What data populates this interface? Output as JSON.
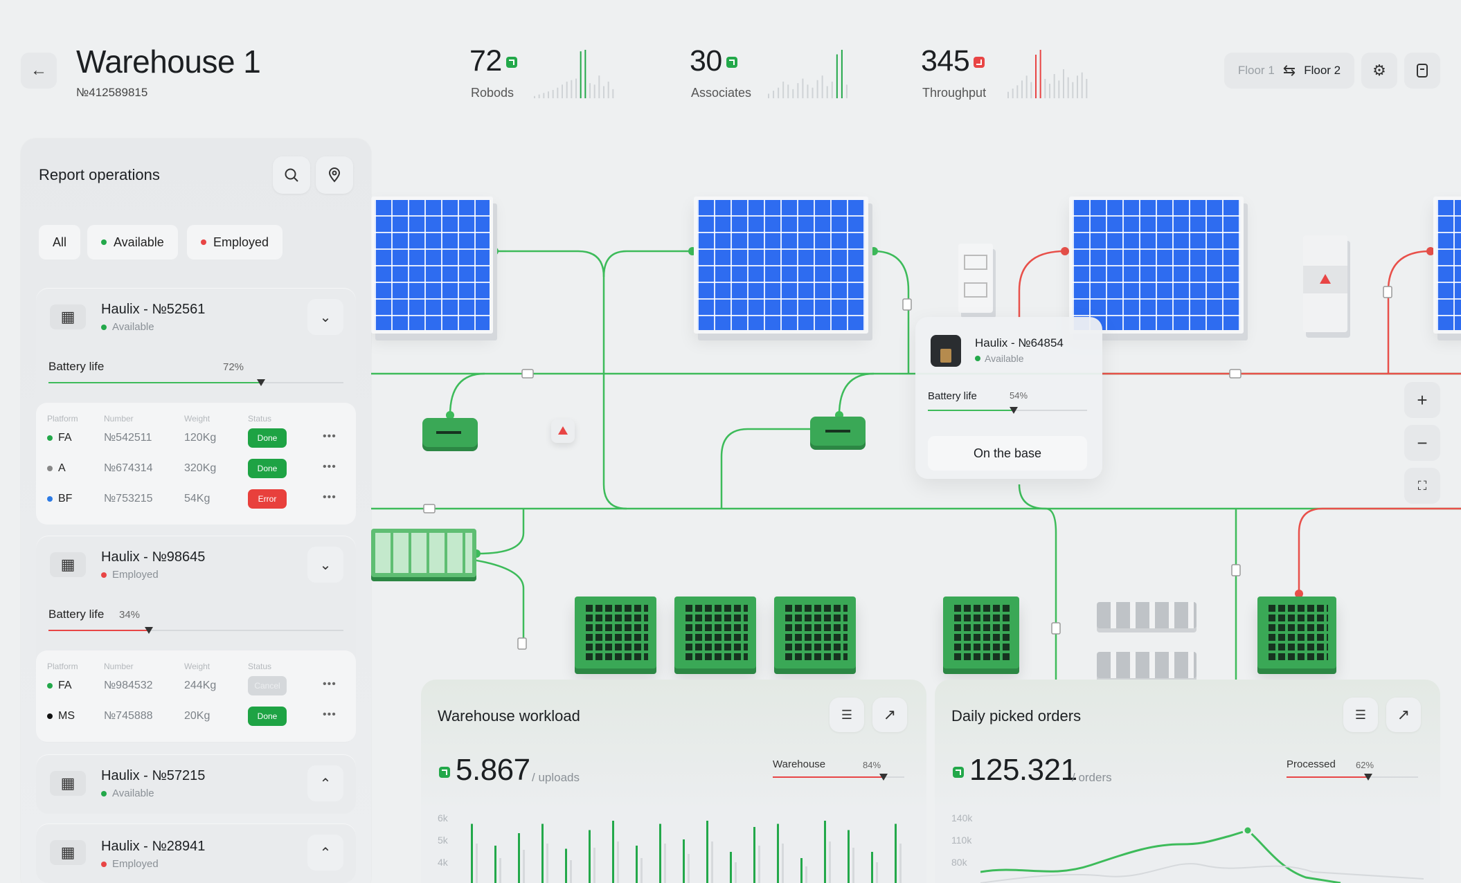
{
  "header": {
    "title": "Warehouse 1",
    "id": "№412589815",
    "stats": [
      {
        "value": "72",
        "label": "Robods",
        "trend": "up",
        "bars": [
          3,
          5,
          7,
          9,
          11,
          14,
          18,
          22,
          24,
          26,
          62,
          64,
          20,
          18,
          30,
          16,
          22,
          12
        ],
        "accent_index": [
          10,
          11
        ],
        "accent": "#23a84a"
      },
      {
        "value": "30",
        "label": "Associates",
        "trend": "up",
        "bars": [
          6,
          10,
          14,
          22,
          18,
          12,
          20,
          26,
          18,
          14,
          24,
          30,
          16,
          22,
          58,
          64,
          18
        ],
        "accent_index": [
          14,
          15
        ],
        "accent": "#23a84a"
      },
      {
        "value": "345",
        "label": "Throughput",
        "trend": "down",
        "bars": [
          8,
          12,
          16,
          22,
          28,
          20,
          54,
          60,
          24,
          18,
          30,
          22,
          36,
          26,
          20,
          28,
          32,
          24
        ],
        "accent_index": [
          6,
          7
        ],
        "accent": "#e84545"
      }
    ],
    "floor_1": "Floor 1",
    "floor_2": "Floor 2"
  },
  "icons": {
    "back": "arrow-left-icon",
    "swap": "swap-icon",
    "settings": "gear-icon",
    "notes": "note-icon",
    "search": "search-icon",
    "pin": "location-pin-icon"
  },
  "panel": {
    "title": "Report operations",
    "filters": [
      "All",
      "Available",
      "Employed"
    ],
    "robots": [
      {
        "name": "Haulix - №52561",
        "status": "Available",
        "battery_label": "Battery life",
        "battery_pct": "72%",
        "battery": 0.72,
        "headers": [
          "Platform",
          "Number",
          "Weight",
          "Status"
        ],
        "rows": [
          {
            "platform": "FA",
            "dot": "g",
            "number": "№542511",
            "weight": "120Kg",
            "status": "Done"
          },
          {
            "platform": "A",
            "dot": "gray",
            "number": "№674314",
            "weight": "320Kg",
            "status": "Done"
          },
          {
            "platform": "BF",
            "dot": "b",
            "number": "№753215",
            "weight": "54Kg",
            "status": "Error"
          }
        ]
      },
      {
        "name": "Haulix - №98645",
        "status": "Employed",
        "battery_label": "Battery life",
        "battery_pct": "34%",
        "battery": 0.34,
        "headers": [
          "Platform",
          "Number",
          "Weight",
          "Status"
        ],
        "rows": [
          {
            "platform": "FA",
            "dot": "g",
            "number": "№984532",
            "weight": "244Kg",
            "status": "Cancel"
          },
          {
            "platform": "MS",
            "dot": "k",
            "number": "№745888",
            "weight": "20Kg",
            "status": "Done"
          }
        ]
      },
      {
        "name": "Haulix - №57215",
        "status": "Available"
      },
      {
        "name": "Haulix - №28941",
        "status": "Employed"
      }
    ]
  },
  "popup": {
    "name": "Haulix - №64854",
    "status": "Available",
    "battery_label": "Battery life",
    "battery_pct": "54%",
    "battery": 0.54,
    "button": "On the base"
  },
  "workload": {
    "title": "Warehouse workload",
    "value": "5.867",
    "unit": "/ uploads",
    "gauge_label": "Warehouse",
    "gauge_pct": "84%",
    "gauge": 0.84,
    "axis": [
      "6k",
      "5k",
      "4k"
    ]
  },
  "orders": {
    "title": "Daily picked orders",
    "value": "125.321",
    "unit": "/ orders",
    "gauge_label": "Processed",
    "gauge_pct": "62%",
    "gauge": 0.62,
    "axis": [
      "140k",
      "110k",
      "80k"
    ]
  },
  "colors": {
    "green": "#23a84a",
    "red": "#e84545",
    "solar_blue": "#2e6cf0"
  }
}
